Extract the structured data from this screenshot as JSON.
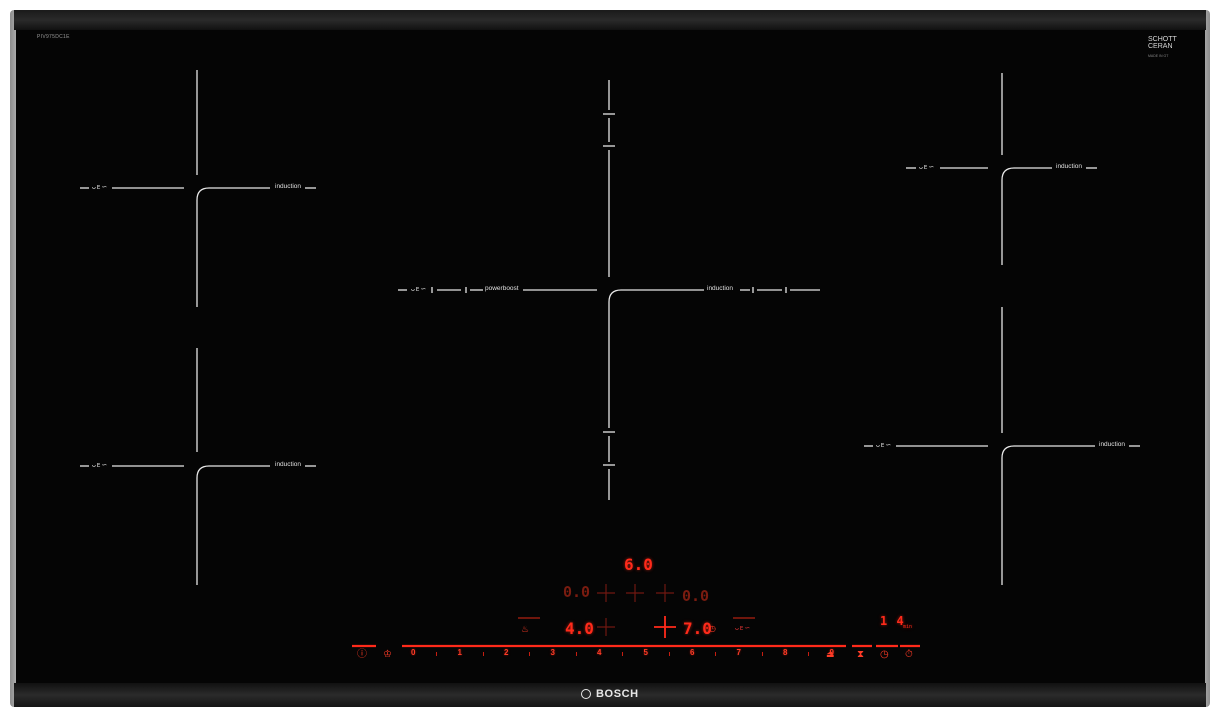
{
  "appliance": {
    "model_code": "PIV975DC1E",
    "glass_brand_line1": "SCHOTT",
    "glass_brand_line2": "CERAN",
    "glass_brand_sub": "MADE IN GT",
    "brand": "BOSCH"
  },
  "zones": {
    "front_left": {
      "label": "induction",
      "icon": "flex-zone-icon"
    },
    "rear_left": {
      "label": "induction",
      "icon": "flex-zone-icon"
    },
    "center": {
      "label": "induction",
      "boost_label": "powerboost",
      "icon": "flex-zone-icon"
    },
    "rear_right": {
      "label": "induction",
      "icon": "flex-zone-icon"
    },
    "front_right": {
      "label": "induction",
      "icon": "flex-zone-icon"
    }
  },
  "display": {
    "top_value": "6.0",
    "left_mid_value": "0.0",
    "right_mid_value": "0.0",
    "left_low_value": "4.0",
    "right_low_value": "7.0",
    "timer_value": "1 4",
    "timer_unit": "min"
  },
  "controls": {
    "power_levels": [
      "0",
      "1",
      "2",
      "3",
      "4",
      "5",
      "6",
      "7",
      "8",
      "9"
    ],
    "accent_color": "#ff2a1a"
  }
}
